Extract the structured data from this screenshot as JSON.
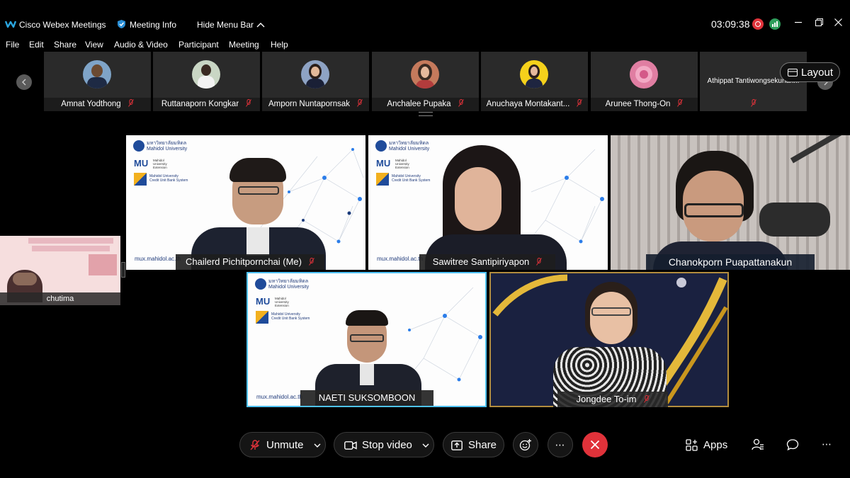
{
  "titlebar": {
    "app_name": "Cisco Webex Meetings",
    "meeting_info": "Meeting Info",
    "hide_menu_bar": "Hide Menu Bar",
    "timer": "03:09:38"
  },
  "menu": {
    "items": [
      "File",
      "Edit",
      "Share",
      "View",
      "Audio & Video",
      "Participant",
      "Meeting",
      "Help"
    ]
  },
  "thumbnails": [
    {
      "name": "Amnat Yodthong"
    },
    {
      "name": "Ruttanaporn Kongkar"
    },
    {
      "name": "Amporn Nuntapornsak"
    },
    {
      "name": "Anchalee Pupaka"
    },
    {
      "name": "Anuchaya Montakant..."
    },
    {
      "name": "Arunee Thong-On"
    },
    {
      "name": "Athippat Tantiwongsekunak..."
    }
  ],
  "layout_button": "Layout",
  "side_tile": {
    "name": "chutima"
  },
  "videos": [
    {
      "name": "Chailerd Pichitpornchai (Me)",
      "site": "mux.mahidol.ac.th"
    },
    {
      "name": "Sawitree Santipiriyapon",
      "site": "mux.mahidol.ac.th"
    },
    {
      "name": "Chanokporn Puapattanakun"
    },
    {
      "name": "NAETI SUKSOMBOON",
      "site": "mux.mahidol.ac.th"
    },
    {
      "name": "Jongdee To-im"
    }
  ],
  "branding": {
    "thai_name": "มหาวิทยาลัยมหิดล",
    "university": "Mahidol University",
    "mu": "MU",
    "credit_line1": "Mahidol University",
    "credit_line2": "Credit Unit Bank System",
    "mux_line1": "Mahidol",
    "mux_line2": "University",
    "mux_line3": "Extension"
  },
  "controls": {
    "unmute": "Unmute",
    "stop_video": "Stop video",
    "share": "Share",
    "apps": "Apps"
  },
  "colors": {
    "active_speaker": "#4fc3f7",
    "end_call": "#e0323a",
    "muted": "#e0323a"
  }
}
